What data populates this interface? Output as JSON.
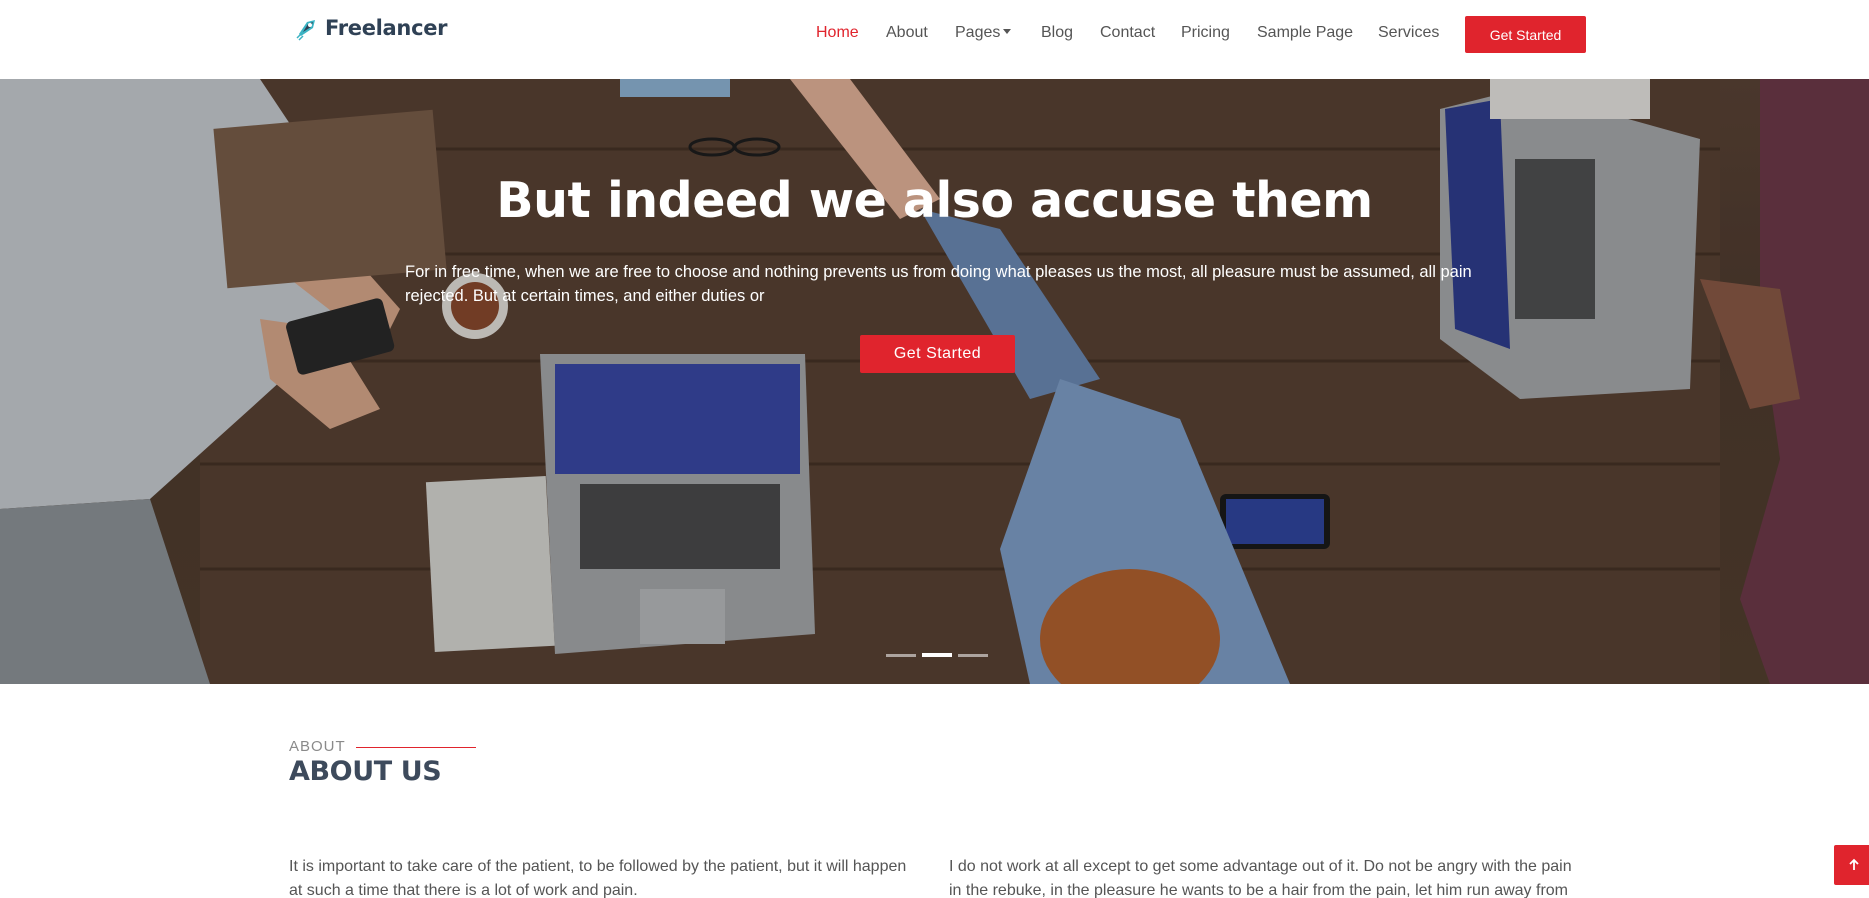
{
  "brand": {
    "name": "Freelancer",
    "icon": "rocket-icon",
    "accent": "#e0242d"
  },
  "nav": {
    "items": [
      {
        "label": "Home",
        "active": true
      },
      {
        "label": "About"
      },
      {
        "label": "Pages",
        "dropdown": true
      },
      {
        "label": "Blog"
      },
      {
        "label": "Contact"
      },
      {
        "label": "Pricing"
      },
      {
        "label": "Sample Page"
      },
      {
        "label": "Services"
      }
    ],
    "cta_label": "Get Started"
  },
  "hero": {
    "title": "But indeed we also accuse them",
    "text": "For in free time, when we are free to choose and nothing prevents us from doing what pleases us the most, all pleasure must be assumed, all pain rejected. But at certain times, and either duties or",
    "button_label": "Get Started",
    "slides": {
      "count": 3,
      "active": 2
    }
  },
  "about": {
    "label": "ABOUT",
    "title": "ABOUT US",
    "p1": "It is important to take care of the patient, to be followed by the patient, but it will happen at such a time that there is a lot of work and pain.",
    "p2": "I do not work at all except to get some advantage out of it. Do not be angry with the pain in the rebuke, in the pleasure he wants to be a hair from the pain, let him run away from"
  },
  "back_to_top": {
    "icon": "arrow-up-icon"
  }
}
